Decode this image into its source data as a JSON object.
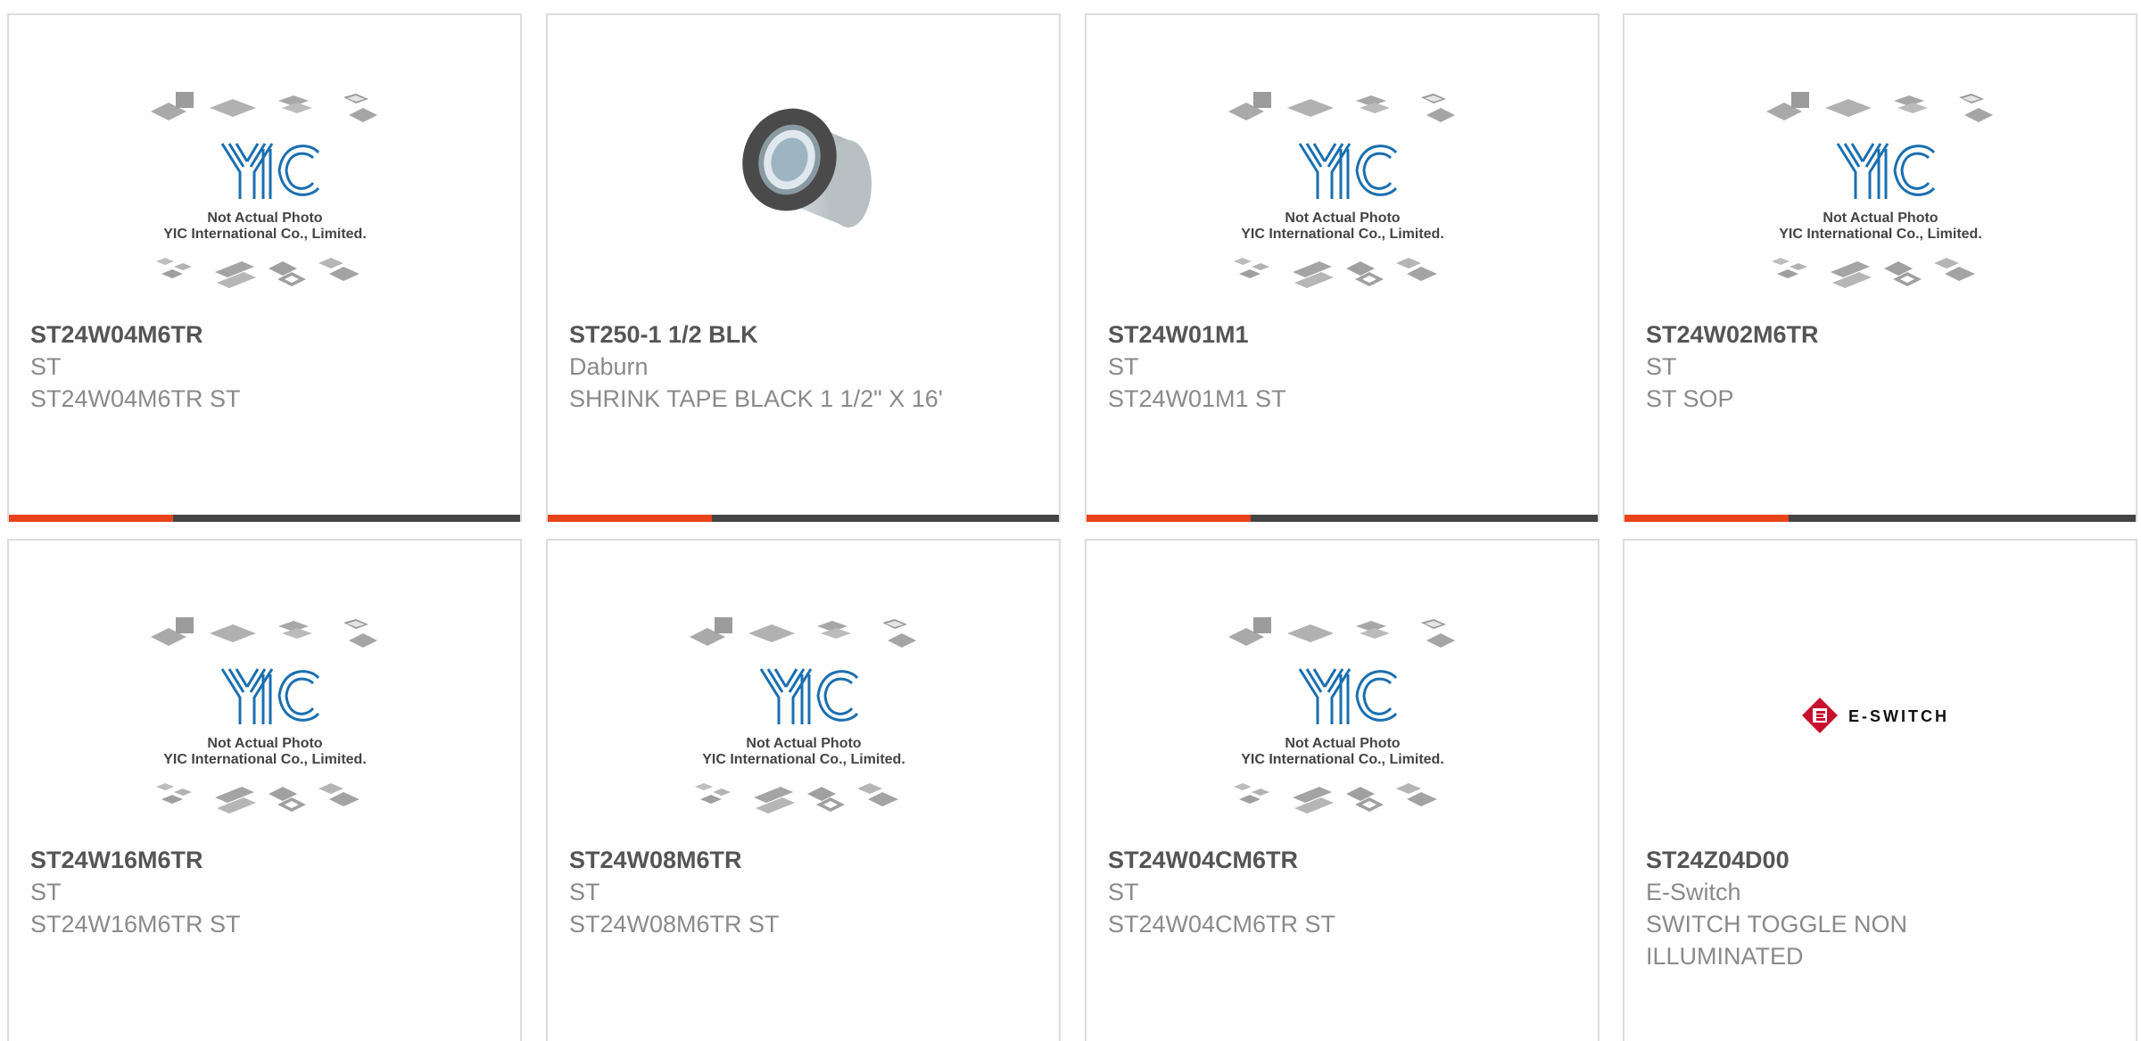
{
  "colors": {
    "accent": "#e8431a",
    "bar_dark": "#444444",
    "part_text": "#555555",
    "meta_text": "#8a8a8a",
    "yic_blue": "#1a6fb0",
    "eswitch_red": "#c8102e"
  },
  "placeholder": {
    "line1": "Not Actual Photo",
    "line2": "YIC International Co., Limited.",
    "logo": "YIC"
  },
  "products": [
    {
      "part": "ST24W04M6TR",
      "maker": "ST",
      "desc": "ST24W04M6TR ST",
      "image": "yic-placeholder"
    },
    {
      "part": "ST250-1 1/2 BLK",
      "maker": "Daburn",
      "desc": "SHRINK TAPE BLACK 1 1/2\" X 16'",
      "image": "tape-roll"
    },
    {
      "part": "ST24W01M1",
      "maker": "ST",
      "desc": "ST24W01M1 ST",
      "image": "yic-placeholder"
    },
    {
      "part": "ST24W02M6TR",
      "maker": "ST",
      "desc": "ST SOP",
      "image": "yic-placeholder"
    },
    {
      "part": "ST24W16M6TR",
      "maker": "ST",
      "desc": "ST24W16M6TR ST",
      "image": "yic-placeholder"
    },
    {
      "part": "ST24W08M6TR",
      "maker": "ST",
      "desc": "ST24W08M6TR ST",
      "image": "yic-placeholder"
    },
    {
      "part": "ST24W04CM6TR",
      "maker": "ST",
      "desc": "ST24W04CM6TR ST",
      "image": "yic-placeholder"
    },
    {
      "part": "ST24Z04D00",
      "maker": "E-Switch",
      "desc": "SWITCH TOGGLE NON ILLUMINATED",
      "image": "eswitch-logo",
      "logo_text": "E-SWITCH"
    }
  ]
}
